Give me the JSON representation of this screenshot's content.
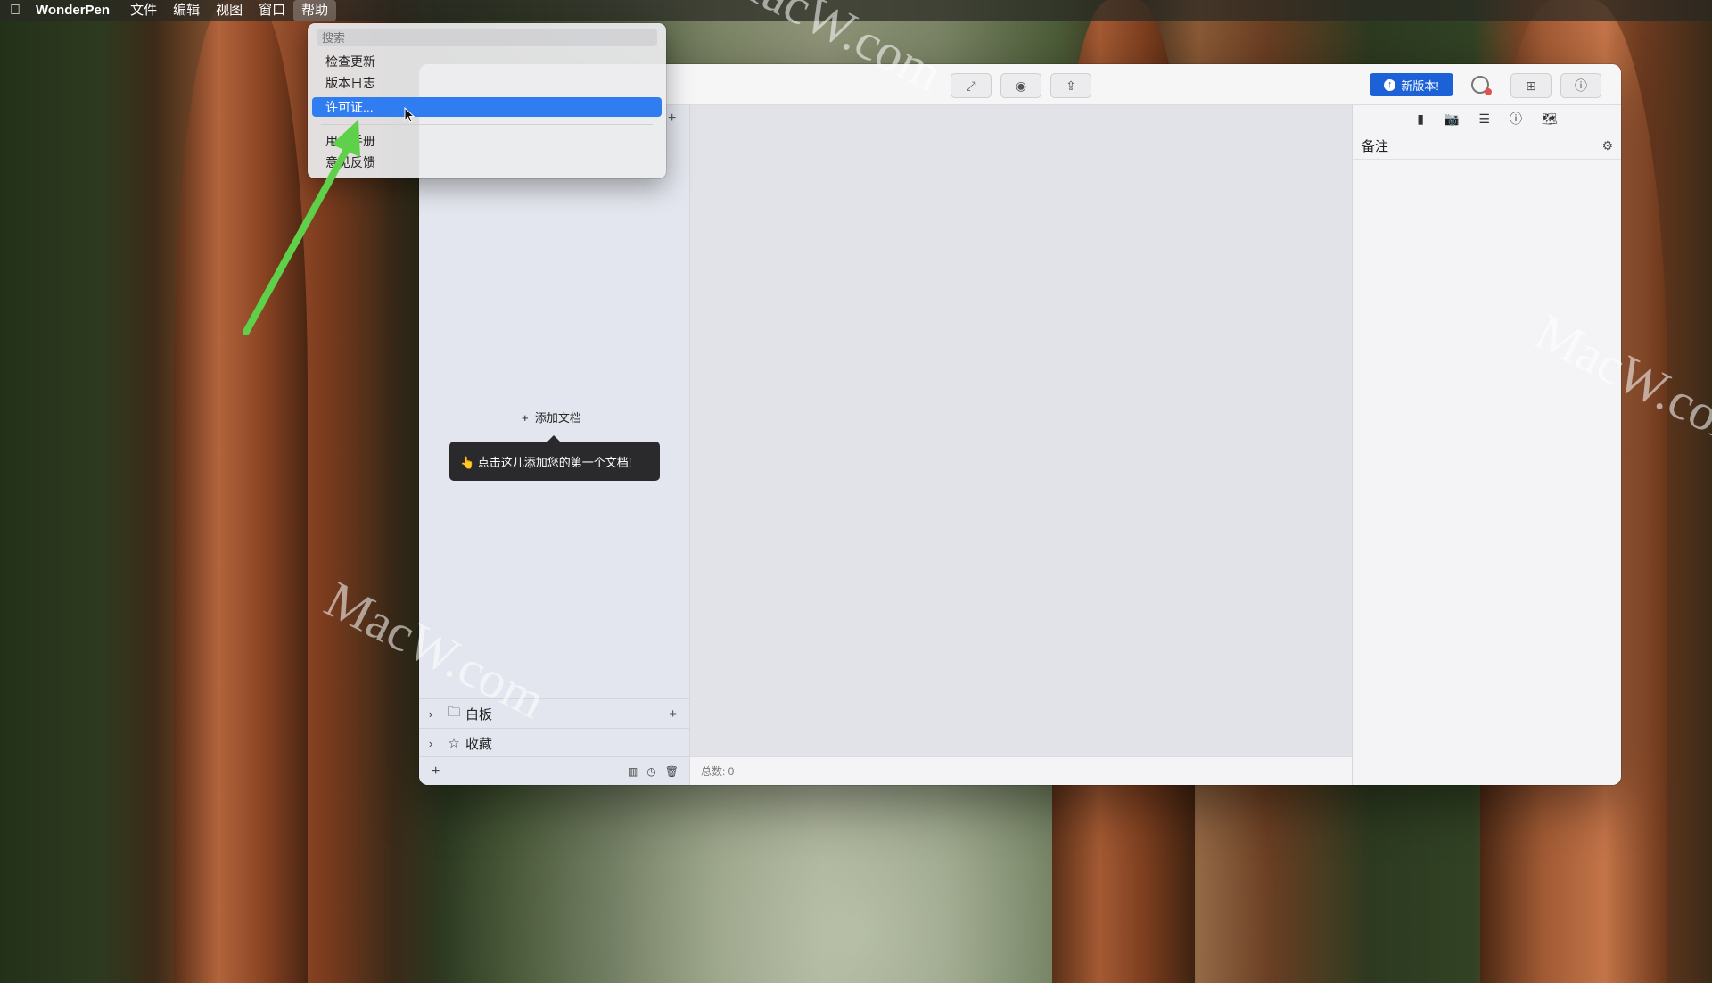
{
  "menubar": {
    "apple": "",
    "app": "WonderPen",
    "items": [
      "文件",
      "编辑",
      "视图",
      "窗口",
      "帮助"
    ]
  },
  "help_menu": {
    "search_placeholder": "搜索",
    "items": [
      "检查更新",
      "版本日志",
      "许可证...",
      "用户手册",
      "意见反馈"
    ],
    "highlighted": "许可证..."
  },
  "toolbar": {
    "new_version_label": "新版本!"
  },
  "sidebar": {
    "add_document": "添加文档",
    "tooltip": "👆 点击这儿添加您的第一个文档!",
    "sections": [
      {
        "label": "白板"
      },
      {
        "label": "收藏"
      }
    ]
  },
  "status": {
    "total": "总数: 0"
  },
  "right_panel": {
    "title": "备注"
  },
  "watermark": "MacW.com",
  "colors": {
    "accent": "#1c62d6",
    "menu_highlight": "#2f7df0",
    "arrow": "#5fd04a"
  }
}
